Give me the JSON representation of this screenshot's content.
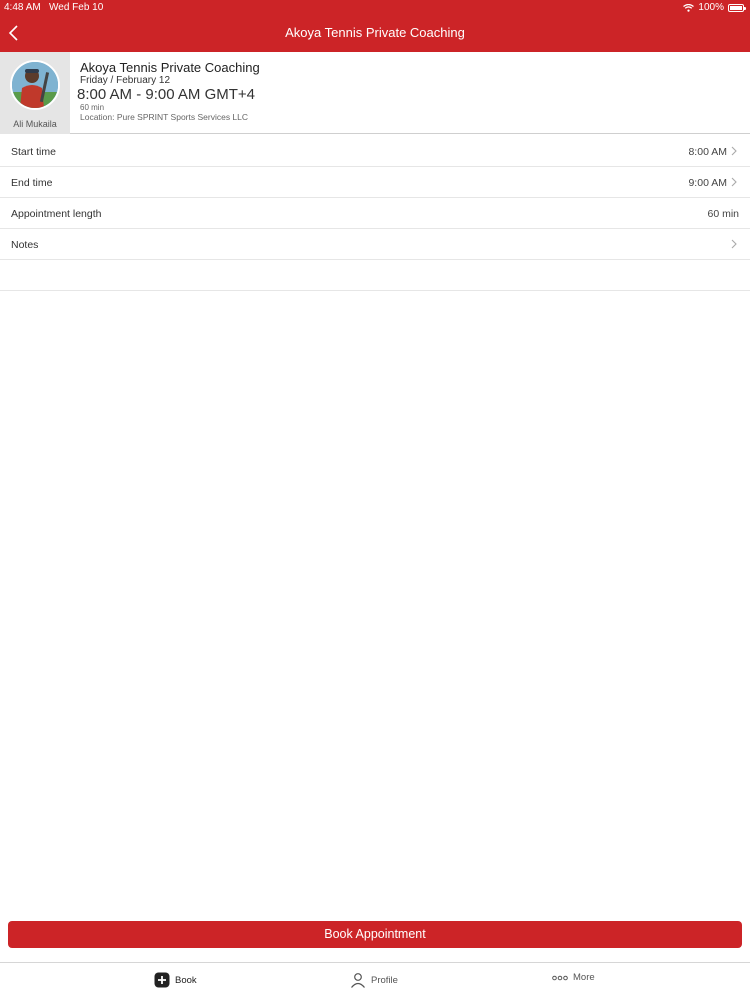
{
  "status_bar": {
    "time": "4:48 AM",
    "date": "Wed Feb 10",
    "battery": "100%"
  },
  "nav": {
    "title": "Akoya Tennis Private Coaching",
    "back_icon": "chevron-left-icon"
  },
  "appointment": {
    "coach_name": "Ali Mukaila",
    "title": "Akoya Tennis Private Coaching",
    "date": "Friday / February 12",
    "time_range": "8:00 AM - 9:00 AM GMT+4",
    "length": "60 min",
    "location": "Location: Pure SPRINT Sports Services LLC"
  },
  "rows": [
    {
      "label": "Start time",
      "value": "8:00 AM"
    },
    {
      "label": "End time",
      "value": "9:00 AM"
    },
    {
      "label": "Appointment length",
      "value": "60 min"
    },
    {
      "label": "Notes",
      "value": ""
    }
  ],
  "book_button": "Book Appointment",
  "tabs": [
    {
      "label": "Book",
      "icon": "plus-square-icon"
    },
    {
      "label": "Profile",
      "icon": "person-icon"
    },
    {
      "label": "More",
      "icon": "ellipsis-icon"
    }
  ],
  "colors": {
    "brand": "#cc2427"
  }
}
